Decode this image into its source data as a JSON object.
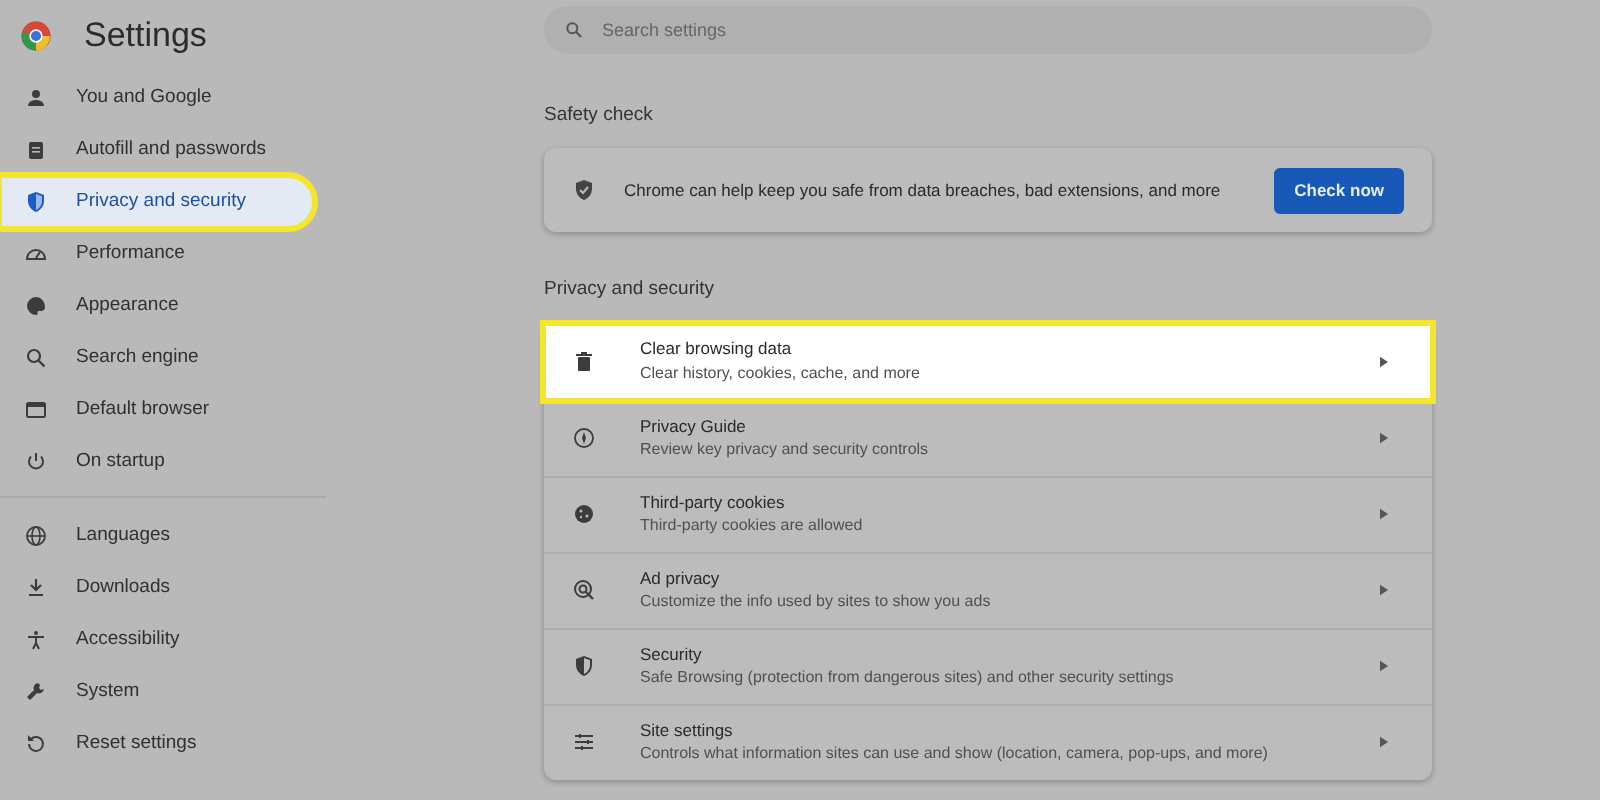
{
  "header": {
    "title": "Settings"
  },
  "sidebar": {
    "items": [
      {
        "label": "You and Google",
        "selected": false,
        "highlighted": false
      },
      {
        "label": "Autofill and passwords",
        "selected": false,
        "highlighted": false
      },
      {
        "label": "Privacy and security",
        "selected": true,
        "highlighted": true
      },
      {
        "label": "Performance",
        "selected": false,
        "highlighted": false
      },
      {
        "label": "Appearance",
        "selected": false,
        "highlighted": false
      },
      {
        "label": "Search engine",
        "selected": false,
        "highlighted": false
      },
      {
        "label": "Default browser",
        "selected": false,
        "highlighted": false
      },
      {
        "label": "On startup",
        "selected": false,
        "highlighted": false
      }
    ],
    "more_items": [
      {
        "label": "Languages",
        "selected": false,
        "highlighted": false
      },
      {
        "label": "Downloads",
        "selected": false,
        "highlighted": false
      },
      {
        "label": "Accessibility",
        "selected": false,
        "highlighted": false
      },
      {
        "label": "System",
        "selected": false,
        "highlighted": false
      },
      {
        "label": "Reset settings",
        "selected": false,
        "highlighted": false
      }
    ]
  },
  "search": {
    "placeholder": "Search settings"
  },
  "safety_check": {
    "heading": "Safety check",
    "text": "Chrome can help keep you safe from data breaches, bad extensions, and more",
    "button": "Check now"
  },
  "privacy": {
    "heading": "Privacy and security",
    "rows": [
      {
        "title": "Clear browsing data",
        "subtitle": "Clear history, cookies, cache, and more",
        "highlighted": true
      },
      {
        "title": "Privacy Guide",
        "subtitle": "Review key privacy and security controls",
        "highlighted": false
      },
      {
        "title": "Third-party cookies",
        "subtitle": "Third-party cookies are allowed",
        "highlighted": false
      },
      {
        "title": "Ad privacy",
        "subtitle": "Customize the info used by sites to show you ads",
        "highlighted": false
      },
      {
        "title": "Security",
        "subtitle": "Safe Browsing (protection from dangerous sites) and other security settings",
        "highlighted": false
      },
      {
        "title": "Site settings",
        "subtitle": "Controls what information sites can use and show (location, camera, pop-ups, and more)",
        "highlighted": false
      }
    ]
  }
}
